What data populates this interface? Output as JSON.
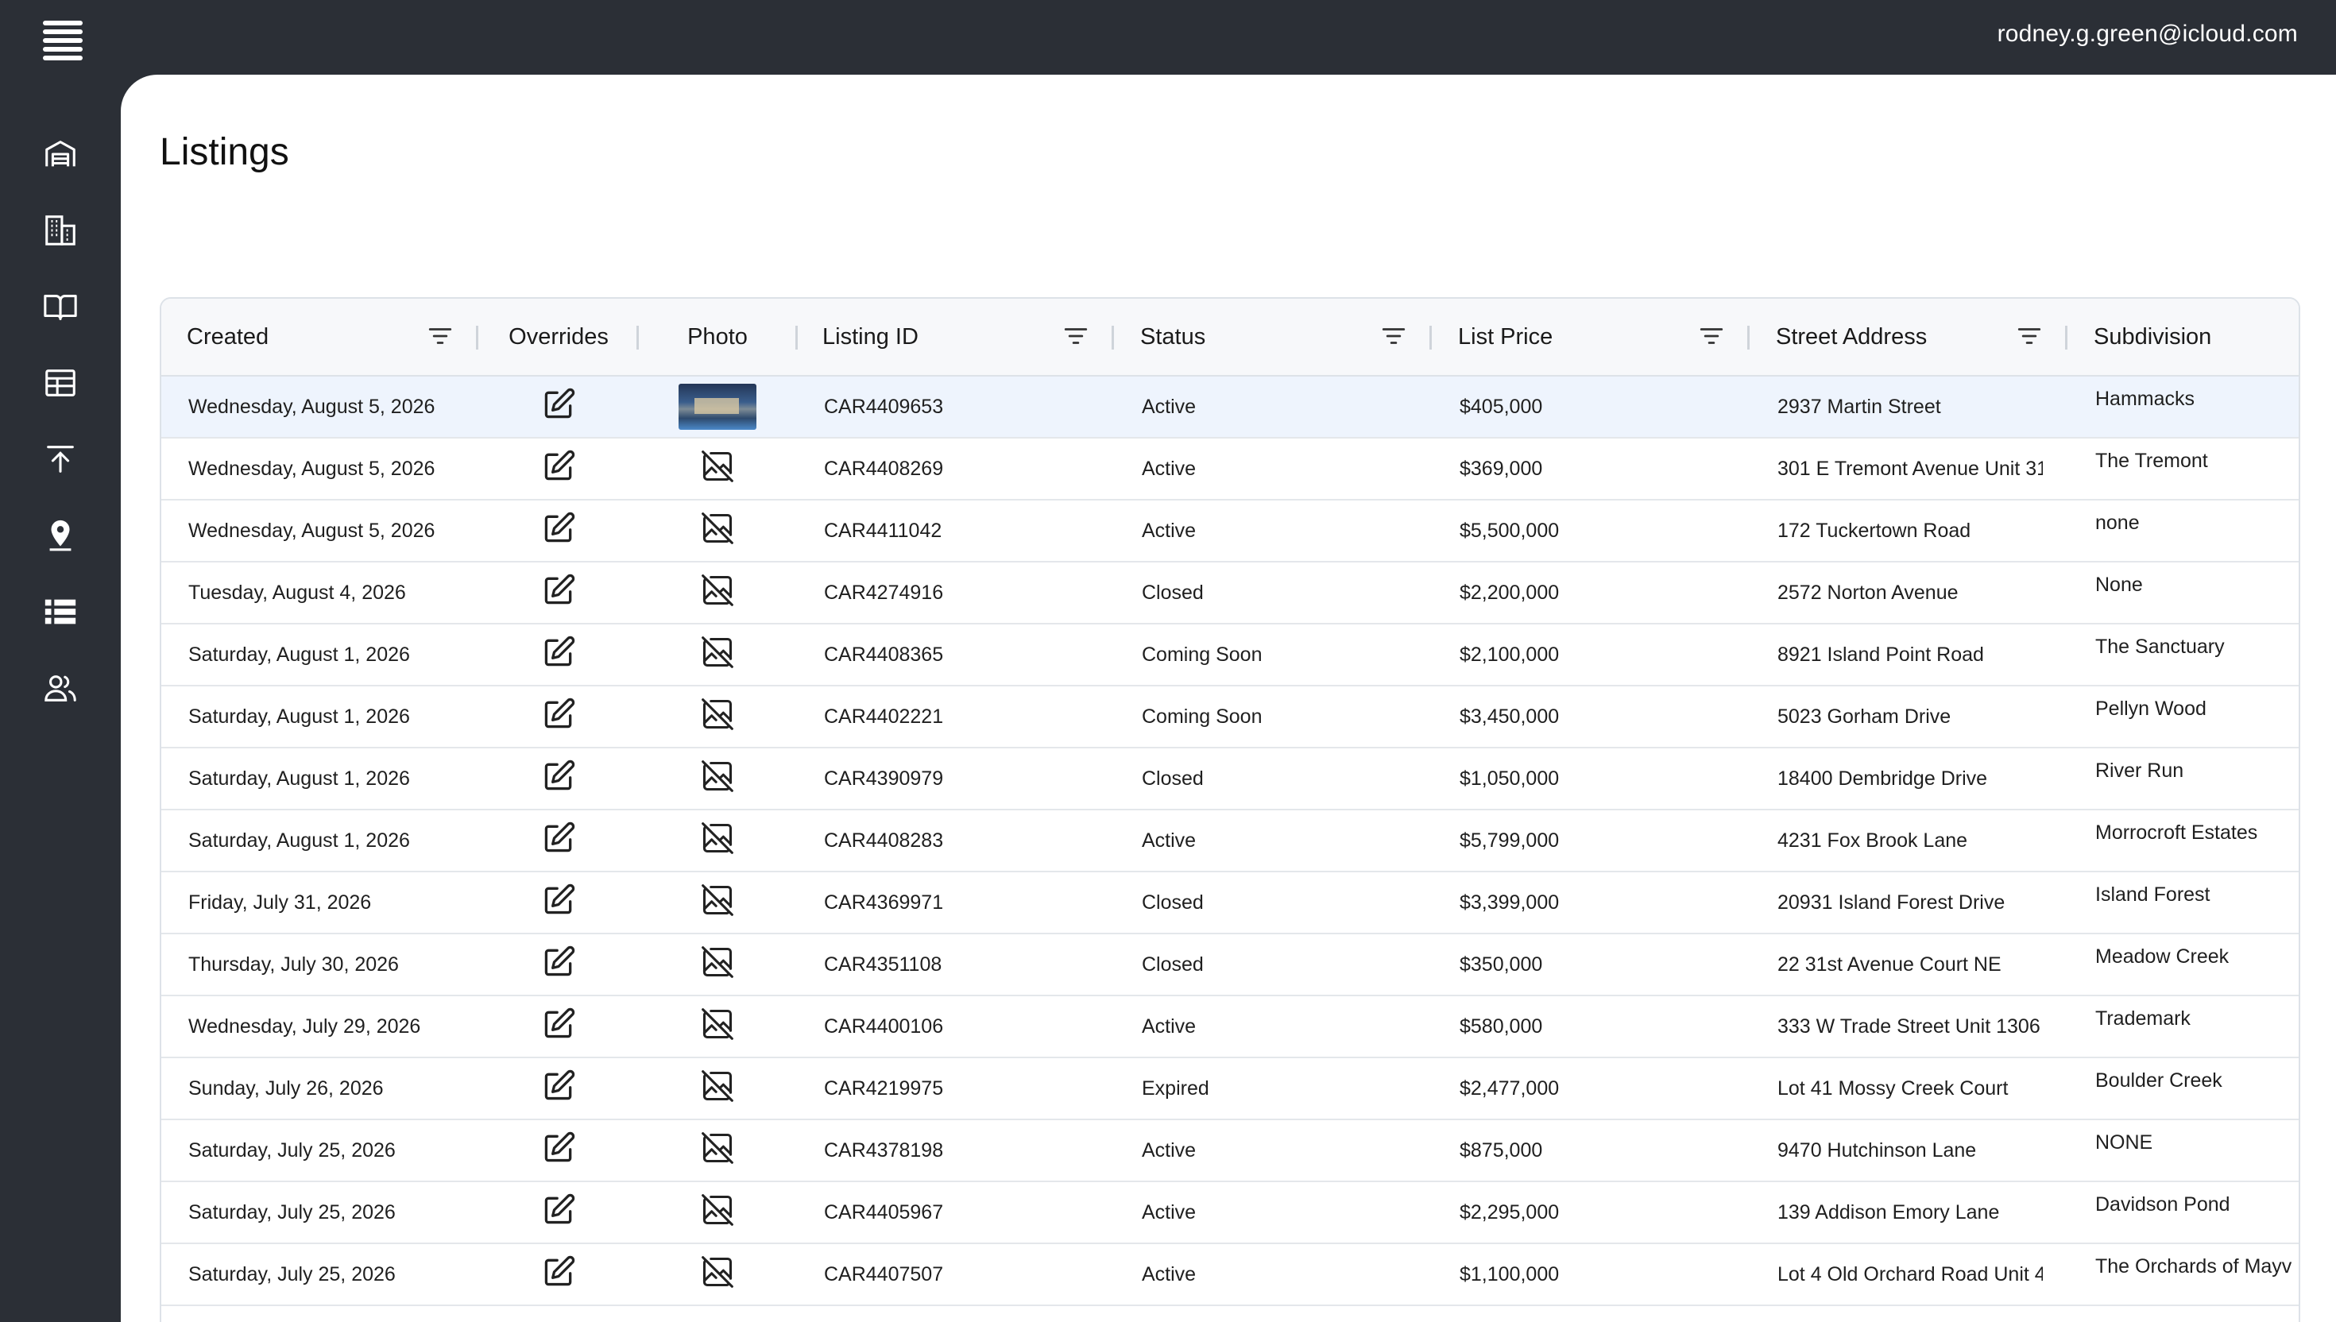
{
  "header": {
    "user_email": "rodney.g.green@icloud.com"
  },
  "sidebar": {
    "items": [
      {
        "icon": "warehouse-icon",
        "name": "nav-warehouse"
      },
      {
        "icon": "building-icon",
        "name": "nav-buildings"
      },
      {
        "icon": "book-icon",
        "name": "nav-book"
      },
      {
        "icon": "table-icon",
        "name": "nav-table"
      },
      {
        "icon": "upload-icon",
        "name": "nav-upload"
      },
      {
        "icon": "location-pin-icon",
        "name": "nav-location"
      },
      {
        "icon": "list-icon",
        "name": "nav-list"
      },
      {
        "icon": "users-icon",
        "name": "nav-users"
      }
    ]
  },
  "page": {
    "title": "Listings"
  },
  "table": {
    "columns": {
      "created": "Created",
      "overrides": "Overrides",
      "photo": "Photo",
      "listing_id": "Listing ID",
      "status": "Status",
      "list_price": "List Price",
      "street_address": "Street Address",
      "subdivision": "Subdivision"
    },
    "rows": [
      {
        "created": "Wednesday, August 5, 2026",
        "photo": "thumbnail",
        "listing_id": "CAR4409653",
        "status": "Active",
        "list_price": "$405,000",
        "street_address": "2937 Martin Street",
        "subdivision": "Hammacks"
      },
      {
        "created": "Wednesday, August 5, 2026",
        "photo": "none",
        "listing_id": "CAR4408269",
        "status": "Active",
        "list_price": "$369,000",
        "street_address": "301 E Tremont Avenue Unit 31",
        "subdivision": "The Tremont"
      },
      {
        "created": "Wednesday, August 5, 2026",
        "photo": "none",
        "listing_id": "CAR4411042",
        "status": "Active",
        "list_price": "$5,500,000",
        "street_address": "172 Tuckertown Road",
        "subdivision": "none"
      },
      {
        "created": "Tuesday, August 4, 2026",
        "photo": "none",
        "listing_id": "CAR4274916",
        "status": "Closed",
        "list_price": "$2,200,000",
        "street_address": "2572 Norton Avenue",
        "subdivision": "None"
      },
      {
        "created": "Saturday, August 1, 2026",
        "photo": "none",
        "listing_id": "CAR4408365",
        "status": "Coming Soon",
        "list_price": "$2,100,000",
        "street_address": "8921 Island Point Road",
        "subdivision": "The Sanctuary"
      },
      {
        "created": "Saturday, August 1, 2026",
        "photo": "none",
        "listing_id": "CAR4402221",
        "status": "Coming Soon",
        "list_price": "$3,450,000",
        "street_address": "5023 Gorham Drive",
        "subdivision": "Pellyn Wood"
      },
      {
        "created": "Saturday, August 1, 2026",
        "photo": "none",
        "listing_id": "CAR4390979",
        "status": "Closed",
        "list_price": "$1,050,000",
        "street_address": "18400 Dembridge Drive",
        "subdivision": "River Run"
      },
      {
        "created": "Saturday, August 1, 2026",
        "photo": "none",
        "listing_id": "CAR4408283",
        "status": "Active",
        "list_price": "$5,799,000",
        "street_address": "4231 Fox Brook Lane",
        "subdivision": "Morrocroft Estates"
      },
      {
        "created": "Friday, July 31, 2026",
        "photo": "none",
        "listing_id": "CAR4369971",
        "status": "Closed",
        "list_price": "$3,399,000",
        "street_address": "20931 Island Forest Drive",
        "subdivision": "Island Forest"
      },
      {
        "created": "Thursday, July 30, 2026",
        "photo": "none",
        "listing_id": "CAR4351108",
        "status": "Closed",
        "list_price": "$350,000",
        "street_address": "22 31st Avenue Court NE",
        "subdivision": "Meadow Creek"
      },
      {
        "created": "Wednesday, July 29, 2026",
        "photo": "none",
        "listing_id": "CAR4400106",
        "status": "Active",
        "list_price": "$580,000",
        "street_address": "333 W Trade Street Unit 1306",
        "subdivision": "Trademark"
      },
      {
        "created": "Sunday, July 26, 2026",
        "photo": "none",
        "listing_id": "CAR4219975",
        "status": "Expired",
        "list_price": "$2,477,000",
        "street_address": "Lot 41 Mossy Creek Court",
        "subdivision": "Boulder Creek"
      },
      {
        "created": "Saturday, July 25, 2026",
        "photo": "none",
        "listing_id": "CAR4378198",
        "status": "Active",
        "list_price": "$875,000",
        "street_address": "9470 Hutchinson Lane",
        "subdivision": "NONE"
      },
      {
        "created": "Saturday, July 25, 2026",
        "photo": "none",
        "listing_id": "CAR4405967",
        "status": "Active",
        "list_price": "$2,295,000",
        "street_address": "139 Addison Emory Lane",
        "subdivision": "Davidson Pond"
      },
      {
        "created": "Saturday, July 25, 2026",
        "photo": "none",
        "listing_id": "CAR4407507",
        "status": "Active",
        "list_price": "$1,100,000",
        "street_address": "Lot 4 Old Orchard Road Unit 4",
        "subdivision": "The Orchards of Mayv"
      }
    ]
  }
}
